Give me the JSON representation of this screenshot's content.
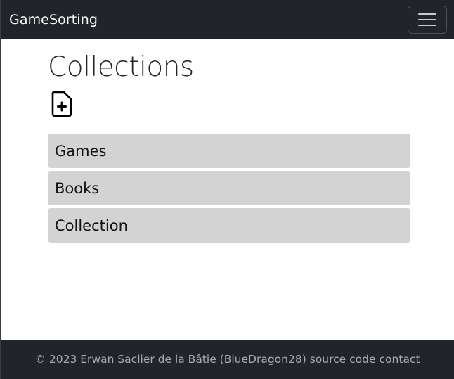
{
  "navbar": {
    "brand": "GameSorting",
    "toggle_icon": "hamburger-menu-icon"
  },
  "main": {
    "title": "Collections",
    "add_icon": "file-plus-icon",
    "collections": [
      {
        "label": "Games"
      },
      {
        "label": "Books"
      },
      {
        "label": "Collection"
      }
    ]
  },
  "footer": {
    "copyright": "© 2023 Erwan Saclier de la Bâtie (BlueDragon28)",
    "source_link": "source code",
    "contact_link": "contact"
  },
  "colors": {
    "navbar_bg": "#212529",
    "item_bg": "#d3d3d3",
    "footer_text": "#a8acb0"
  }
}
